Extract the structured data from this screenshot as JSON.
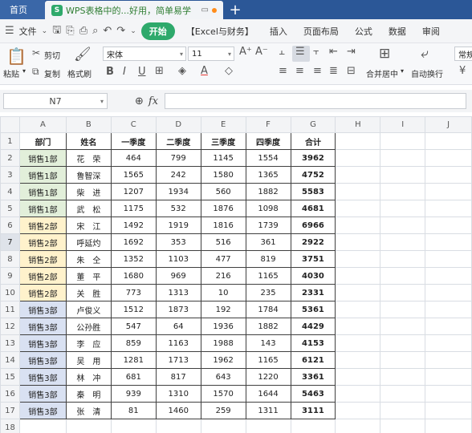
{
  "tabbar": {
    "home": "首页",
    "doc_logo": "S",
    "doc_title": "WPS表格中的...好用，简单易学",
    "new_tab": "+"
  },
  "menu": {
    "file": "文件",
    "start": "开始",
    "items": [
      "【Excel与财务】",
      "插入",
      "页面布局",
      "公式",
      "数据",
      "审阅"
    ]
  },
  "ribbon": {
    "paste": "粘贴",
    "cut": "剪切",
    "copy": "复制",
    "format_painter": "格式刷",
    "font_name": "宋体",
    "font_size": "11",
    "merge_center": "合并居中",
    "wrap_text": "自动换行",
    "number_format": "常规"
  },
  "formula_bar": {
    "cell_ref": "N7",
    "fx": "fx"
  },
  "columns": [
    "A",
    "B",
    "C",
    "D",
    "E",
    "F",
    "G",
    "H",
    "I",
    "J"
  ],
  "row_numbers": [
    "1",
    "2",
    "3",
    "4",
    "5",
    "6",
    "7",
    "8",
    "9",
    "10",
    "11",
    "12",
    "13",
    "14",
    "15",
    "16",
    "17",
    "18"
  ],
  "colors": {
    "dept1": "#e2efda",
    "dept2": "#fff2cc",
    "dept3": "#d9e1f2",
    "accent_green": "#2ea96b",
    "tab_blue": "#2b5797"
  },
  "sheet": {
    "headers": [
      "部门",
      "姓名",
      "一季度",
      "二季度",
      "三季度",
      "四季度",
      "合计"
    ],
    "rows": [
      {
        "dept": "销售1部",
        "name": "花　荣",
        "q1": "464",
        "q2": "799",
        "q3": "1145",
        "q4": "1554",
        "total": "3962",
        "group": 1
      },
      {
        "dept": "销售1部",
        "name": "鲁智深",
        "q1": "1565",
        "q2": "242",
        "q3": "1580",
        "q4": "1365",
        "total": "4752",
        "group": 1
      },
      {
        "dept": "销售1部",
        "name": "柴　进",
        "q1": "1207",
        "q2": "1934",
        "q3": "560",
        "q4": "1882",
        "total": "5583",
        "group": 1
      },
      {
        "dept": "销售1部",
        "name": "武　松",
        "q1": "1175",
        "q2": "532",
        "q3": "1876",
        "q4": "1098",
        "total": "4681",
        "group": 1
      },
      {
        "dept": "销售2部",
        "name": "宋　江",
        "q1": "1492",
        "q2": "1919",
        "q3": "1816",
        "q4": "1739",
        "total": "6966",
        "group": 2
      },
      {
        "dept": "销售2部",
        "name": "呼延灼",
        "q1": "1692",
        "q2": "353",
        "q3": "516",
        "q4": "361",
        "total": "2922",
        "group": 2
      },
      {
        "dept": "销售2部",
        "name": "朱　仝",
        "q1": "1352",
        "q2": "1103",
        "q3": "477",
        "q4": "819",
        "total": "3751",
        "group": 2
      },
      {
        "dept": "销售2部",
        "name": "董　平",
        "q1": "1680",
        "q2": "969",
        "q3": "216",
        "q4": "1165",
        "total": "4030",
        "group": 2
      },
      {
        "dept": "销售2部",
        "name": "关　胜",
        "q1": "773",
        "q2": "1313",
        "q3": "10",
        "q4": "235",
        "total": "2331",
        "group": 2
      },
      {
        "dept": "销售3部",
        "name": "卢俊义",
        "q1": "1512",
        "q2": "1873",
        "q3": "192",
        "q4": "1784",
        "total": "5361",
        "group": 3
      },
      {
        "dept": "销售3部",
        "name": "公孙胜",
        "q1": "547",
        "q2": "64",
        "q3": "1936",
        "q4": "1882",
        "total": "4429",
        "group": 3
      },
      {
        "dept": "销售3部",
        "name": "李　应",
        "q1": "859",
        "q2": "1163",
        "q3": "1988",
        "q4": "143",
        "total": "4153",
        "group": 3
      },
      {
        "dept": "销售3部",
        "name": "吴　用",
        "q1": "1281",
        "q2": "1713",
        "q3": "1962",
        "q4": "1165",
        "total": "6121",
        "group": 3
      },
      {
        "dept": "销售3部",
        "name": "林　冲",
        "q1": "681",
        "q2": "817",
        "q3": "643",
        "q4": "1220",
        "total": "3361",
        "group": 3
      },
      {
        "dept": "销售3部",
        "name": "秦　明",
        "q1": "939",
        "q2": "1310",
        "q3": "1570",
        "q4": "1644",
        "total": "5463",
        "group": 3
      },
      {
        "dept": "销售3部",
        "name": "张　清",
        "q1": "81",
        "q2": "1460",
        "q3": "259",
        "q4": "1311",
        "total": "3111",
        "group": 3
      }
    ]
  }
}
